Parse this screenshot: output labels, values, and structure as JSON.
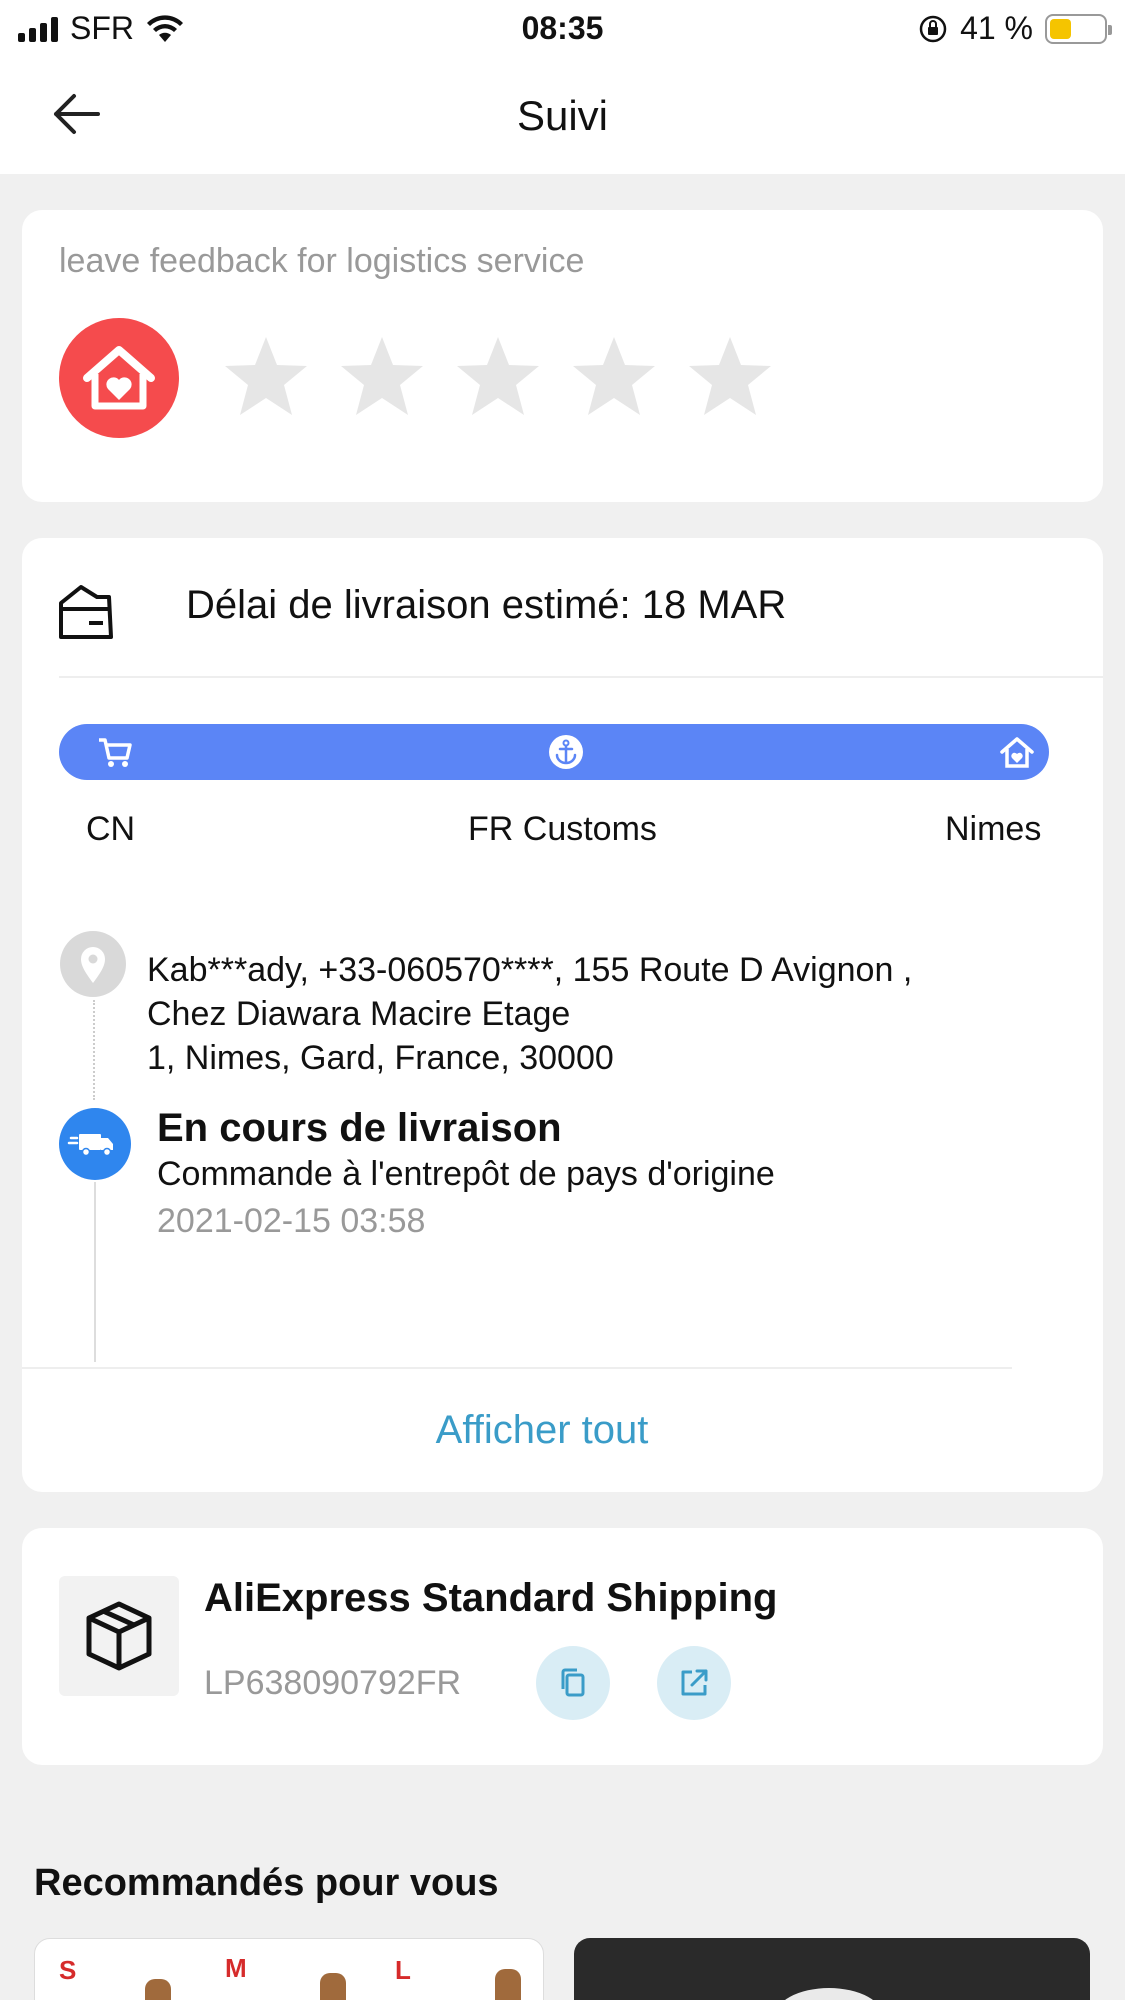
{
  "status_bar": {
    "carrier": "SFR",
    "time": "08:35",
    "battery_percent": "41 %",
    "battery_level": 0.41
  },
  "nav": {
    "title": "Suivi"
  },
  "feedback": {
    "label": "leave feedback for logistics service",
    "rating": 0,
    "max_rating": 5
  },
  "delivery": {
    "estimate": "Délai de livraison estimé: 18 MAR",
    "stops": [
      "CN",
      "FR Customs",
      "Nimes"
    ],
    "address_lines": [
      "Kab***ady,  +33-060570****,  155 Route D Avignon ,",
      "Chez Diawara Macire Etage",
      "1,  Nimes,  Gard,  France,  30000"
    ],
    "status_title": "En cours de livraison",
    "status_desc": "Commande à l'entrepôt de pays d'origine",
    "status_date": "2021-02-15 03:58",
    "show_all": "Afficher tout"
  },
  "shipping": {
    "name": "AliExpress Standard Shipping",
    "tracking_number": "LP638090792FR"
  },
  "recommendations": {
    "title": "Recommandés pour vous",
    "product1_labels": [
      "S",
      "M",
      "L"
    ]
  },
  "colors": {
    "accent_red": "#f54b4d",
    "track_blue": "#5b85f6",
    "truck_blue": "#2f86ee",
    "link": "#3a9cc8"
  },
  "icons": [
    "back-arrow-icon",
    "wifi-icon",
    "rotation-lock-icon",
    "home-heart-icon",
    "star-icon",
    "delivery-box-icon",
    "cart-icon",
    "anchor-icon",
    "home-icon",
    "location-pin-icon",
    "truck-icon",
    "package-icon",
    "copy-icon",
    "external-link-icon"
  ]
}
